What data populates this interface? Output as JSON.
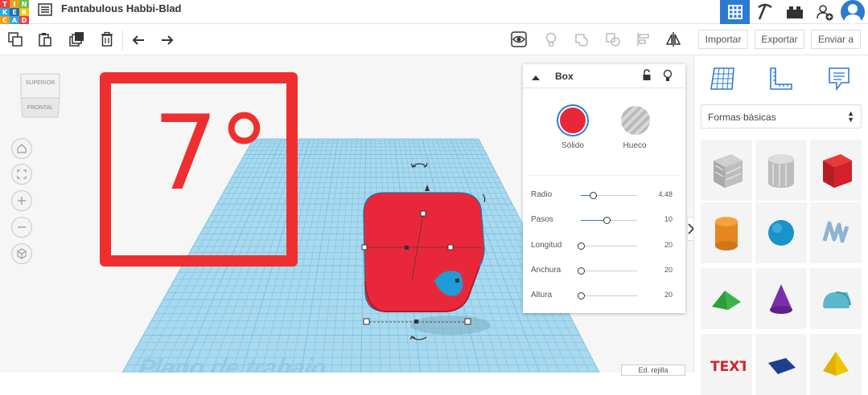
{
  "app": {
    "logo_letters": [
      "TIN",
      "KER",
      "CAD"
    ],
    "project_title": "Fantabulous Habbi-Blad"
  },
  "toolbar": {
    "import_label": "Importar",
    "export_label": "Exportar",
    "send_label": "Enviar a"
  },
  "viewcube": {
    "top_label": "SUPERIOR",
    "front_label": "FRONTAL"
  },
  "workspace": {
    "plane_label": "Plano de trabajo",
    "grid_button_label": "Ed. rejilla"
  },
  "overlay": {
    "text": "7°",
    "color": "#ef2f2f"
  },
  "inspector": {
    "title": "Box",
    "solid_label": "Sólido",
    "hole_label": "Hueco",
    "properties": [
      {
        "label": "Radio",
        "value": "4.48",
        "level": 0.21
      },
      {
        "label": "Pasos",
        "value": "10",
        "level": 0.45
      },
      {
        "label": "Longitud",
        "value": "20",
        "level": 0.0
      },
      {
        "label": "Anchura",
        "value": "20",
        "level": 0.0
      },
      {
        "label": "Altura",
        "value": "20",
        "level": 0.0
      }
    ],
    "solid_color": "#e8283a"
  },
  "rightpanel": {
    "category_select": "Formas básicas",
    "shapes": [
      "box-hole",
      "cylinder-hole",
      "box",
      "cylinder",
      "sphere",
      "scribble",
      "roof",
      "cone",
      "round-roof",
      "text",
      "polygon",
      "pyramid"
    ]
  },
  "colors": {
    "accent": "#2e7ad1",
    "grid": "#a9d9ee",
    "shape_red": "#e8283a",
    "hole_blue": "#1f9bd7"
  }
}
